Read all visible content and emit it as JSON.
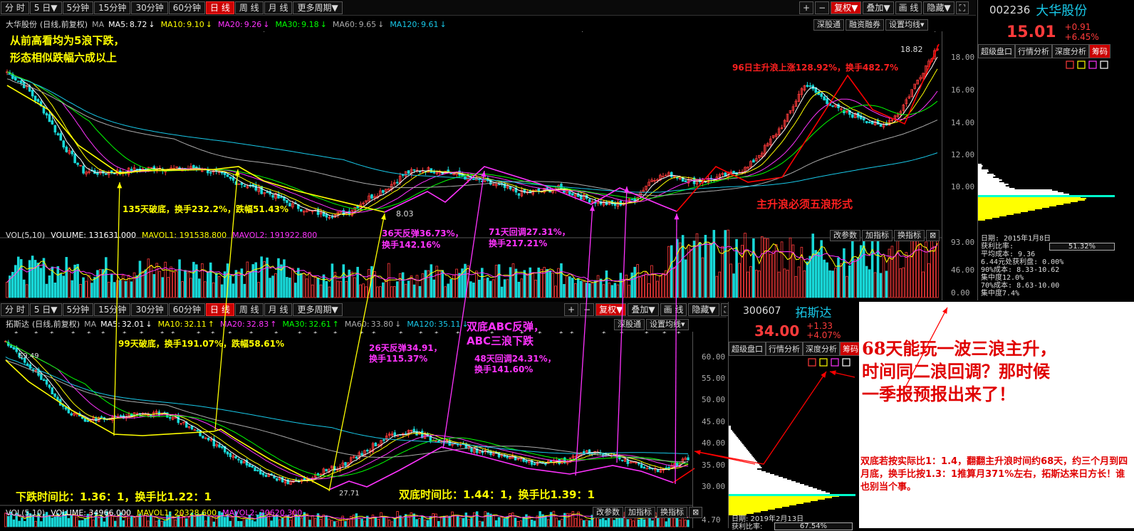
{
  "colors": {
    "up": "#ff3b3b",
    "down": "#18d8d8",
    "yellow": "#ffff00",
    "magenta": "#ff33ff",
    "ma5": "#ffffff",
    "ma10": "#ffff00",
    "ma20": "#ff33ff",
    "ma30": "#00ff00",
    "ma60": "#aaaaaa",
    "ma120": "#18c8e8"
  },
  "toolbar": {
    "tabs": [
      "分 时",
      "5 日▼",
      "5分钟",
      "15分钟",
      "30分钟",
      "60分钟",
      "日 线",
      "周 线",
      "月 线",
      "更多周期▼"
    ],
    "active_index": 6,
    "right": [
      "+",
      "−",
      "复权▼",
      "叠加▼",
      "画 线",
      "隐藏▼",
      "⛶"
    ],
    "right_bottom": [
      "+",
      "−",
      "复权▼",
      "叠加▼",
      "画 线",
      "隐藏▼",
      "⛶"
    ]
  },
  "top_chart": {
    "title": "大华股份",
    "mode": "(日线,前复权)",
    "ma_label": "MA",
    "ma": [
      {
        "k": "MA5:",
        "v": "8.72",
        "arrow": "↓",
        "c": "ma5"
      },
      {
        "k": "MA10:",
        "v": "9.10",
        "arrow": "↓",
        "c": "ma10"
      },
      {
        "k": "MA20:",
        "v": "9.26",
        "arrow": "↓",
        "c": "ma20"
      },
      {
        "k": "MA30:",
        "v": "9.18",
        "arrow": "↓",
        "c": "ma30"
      },
      {
        "k": "MA60:",
        "v": "9.65",
        "arrow": "↓",
        "c": "ma60"
      },
      {
        "k": "MA120:",
        "v": "9.61",
        "arrow": "↓",
        "c": "ma120"
      }
    ],
    "small_buttons": [
      "深股通",
      "融资融券",
      "设置均线▾"
    ],
    "y_ticks": [
      "18.00",
      "16.00",
      "14.00",
      "12.00",
      "10.00"
    ],
    "high_label": "18.82",
    "low_label": "8.03",
    "vol": {
      "label": "VOL(5,10)",
      "volume": "VOLUME: 131631.000",
      "mavol1": "MAVOL1: 191538.800",
      "mavol2": "MAVOL2: 191922.800",
      "buttons": [
        "改参数",
        "加指标",
        "换指标",
        "⊠"
      ],
      "y_ticks": [
        "93.00",
        "46.00",
        "0.00"
      ]
    }
  },
  "bottom_chart": {
    "title": "拓斯达",
    "mode": "(日线,前复权)",
    "ma_label": "MA",
    "ma": [
      {
        "k": "MA5:",
        "v": "32.01",
        "arrow": "↓",
        "c": "ma5"
      },
      {
        "k": "MA10:",
        "v": "32.11",
        "arrow": "↑",
        "c": "ma10"
      },
      {
        "k": "MA20:",
        "v": "32.83",
        "arrow": "↑",
        "c": "ma20"
      },
      {
        "k": "MA30:",
        "v": "32.61",
        "arrow": "↑",
        "c": "ma30"
      },
      {
        "k": "MA60:",
        "v": "33.80",
        "arrow": "↓",
        "c": "ma60"
      },
      {
        "k": "MA120:",
        "v": "35.11",
        "arrow": "↓",
        "c": "ma120"
      }
    ],
    "small_buttons": [
      "深股通",
      "设置均线▾"
    ],
    "y_ticks": [
      "60.00",
      "55.00",
      "50.00",
      "45.00",
      "40.00",
      "35.00",
      "30.00"
    ],
    "high_label": "59.49",
    "low_label": "27.71",
    "vol": {
      "label": "VOL(5,10)",
      "volume": "VOLUME: 34966.000",
      "mavol1": "MAVOL1: 20328.600",
      "mavol2": "MAVOL2: 20620.300",
      "buttons": [
        "改参数",
        "加指标",
        "换指标",
        "⊠"
      ],
      "y_tick": "4.70"
    }
  },
  "right_top": {
    "code": "002236",
    "name": "大华股份",
    "price": "15.01",
    "chg": "+0.91",
    "pct": "+6.45%",
    "tabs": [
      "超级盘口",
      "行情分析",
      "深度分析",
      "筹码"
    ],
    "stats": [
      "日期: 2015年1月8日",
      "获利比率:",
      "平均成本: 9.36",
      "6.44元处获利盘: 0.00%",
      "90%成本: 8.33-10.62",
      "集中度12.0%",
      "70%成本: 8.63-10.00",
      "集中度7.4%"
    ],
    "ratio": "51.32%"
  },
  "right_bottom": {
    "code": "300607",
    "name": "拓斯达",
    "price": "34.00",
    "chg": "+1.33",
    "pct": "+4.07%",
    "tabs": [
      "超级盘口",
      "行情分析",
      "深度分析",
      "筹码"
    ],
    "stats": [
      "日期: 2019年2月13日",
      "获利比率:"
    ],
    "ratio": "67.54%"
  },
  "annotations": {
    "a1": "从前高看均为5浪下跌，",
    "a2": "形态相似跌幅六成以上",
    "a3": "96日主升浪上涨128.92%，换手482.7%",
    "a4": "主升浪必须五浪形式",
    "a5": "135天破底，换手232.2%，跌幅51.43%",
    "a6a": "36天反弹36.73%，",
    "a6b": "换手142.16%",
    "a7a": "71天回调27.31%，",
    "a7b": "换手217.21%",
    "a8": "99天破底，换手191.07%，跌幅58.61%",
    "a9a": "26天反弹34.91，",
    "a9b": "换手115.37%",
    "a10a": "双底ABC反弹，",
    "a10b": "ABC三浪下跌",
    "a11a": "48天回调24.31%，",
    "a11b": "换手141.60%",
    "a12": "下跌时间比：1.36：1，换手比1.22：1",
    "a13": "双底时间比：1.44：1，换手比1.39：1",
    "big1": "68天能玩一波三浪主升，",
    "big2": "时间同二浪回调？那时候",
    "big3": "一季报预报出来了！",
    "note": "双底若按实际比1：1.4，翻翻主升浪时间约68天，约三个月到四月底，换手比按1.3：1推算月371%左右，拓斯达来日方长！谁也别当个事。"
  }
}
